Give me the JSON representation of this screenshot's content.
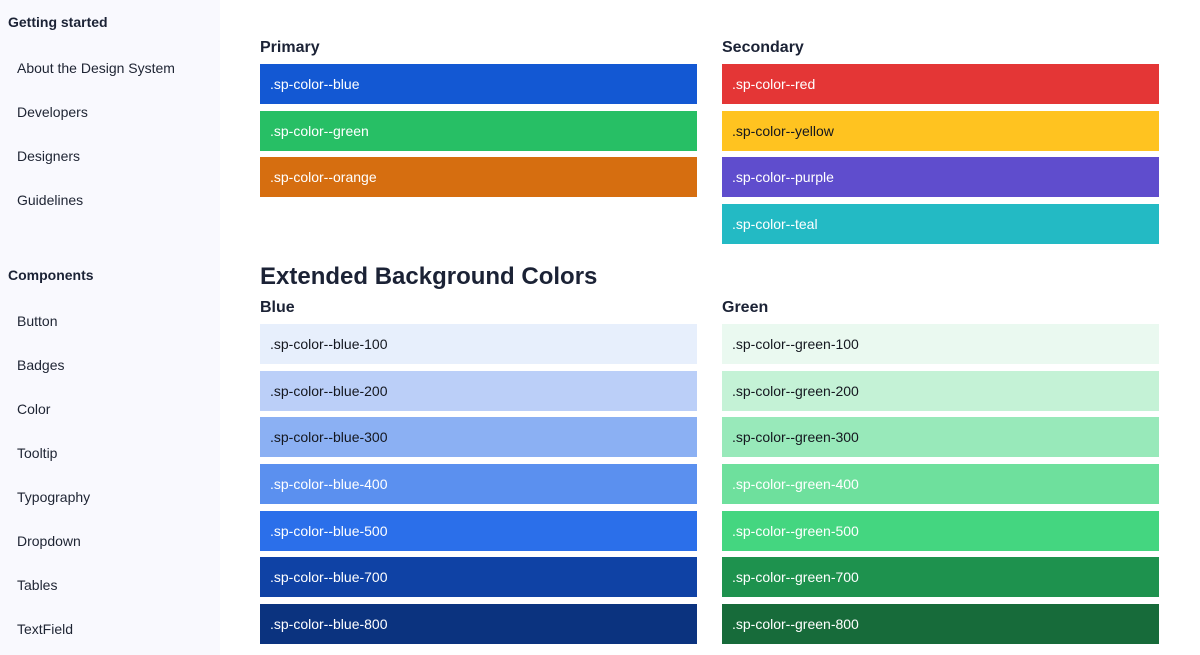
{
  "sidebar": {
    "getting_started": {
      "heading": "Getting started",
      "items": [
        {
          "label": "About the Design System"
        },
        {
          "label": "Developers"
        },
        {
          "label": "Designers"
        },
        {
          "label": "Guidelines"
        }
      ]
    },
    "components": {
      "heading": "Components",
      "items": [
        {
          "label": "Button"
        },
        {
          "label": "Badges"
        },
        {
          "label": "Color"
        },
        {
          "label": "Tooltip"
        },
        {
          "label": "Typography"
        },
        {
          "label": "Dropdown"
        },
        {
          "label": "Tables"
        },
        {
          "label": "TextField"
        }
      ]
    }
  },
  "main": {
    "primary": {
      "heading": "Primary",
      "swatches": [
        {
          "label": ".sp-color--blue",
          "color": "#1358d3",
          "text": "light"
        },
        {
          "label": ".sp-color--green",
          "color": "#27bf65",
          "text": "light"
        },
        {
          "label": ".sp-color--orange",
          "color": "#d66e10",
          "text": "light"
        }
      ]
    },
    "secondary": {
      "heading": "Secondary",
      "swatches": [
        {
          "label": ".sp-color--red",
          "color": "#e43636",
          "text": "light"
        },
        {
          "label": ".sp-color--yellow",
          "color": "#ffc320",
          "text": "dark"
        },
        {
          "label": ".sp-color--purple",
          "color": "#5f4dcd",
          "text": "light"
        },
        {
          "label": ".sp-color--teal",
          "color": "#23bac4",
          "text": "light"
        }
      ]
    },
    "extended": {
      "heading": "Extended Background Colors",
      "blue": {
        "heading": "Blue",
        "swatches": [
          {
            "label": ".sp-color--blue-100",
            "color": "#e7effc",
            "text": "dark"
          },
          {
            "label": ".sp-color--blue-200",
            "color": "#bbcff8",
            "text": "dark"
          },
          {
            "label": ".sp-color--blue-300",
            "color": "#8bb0f3",
            "text": "dark"
          },
          {
            "label": ".sp-color--blue-400",
            "color": "#5b90ef",
            "text": "light"
          },
          {
            "label": ".sp-color--blue-500",
            "color": "#2b6fea",
            "text": "light"
          },
          {
            "label": ".sp-color--blue-700",
            "color": "#0f42a5",
            "text": "light"
          },
          {
            "label": ".sp-color--blue-800",
            "color": "#0b337f",
            "text": "light"
          }
        ]
      },
      "green": {
        "heading": "Green",
        "swatches": [
          {
            "label": ".sp-color--green-100",
            "color": "#eaf9f0",
            "text": "dark"
          },
          {
            "label": ".sp-color--green-200",
            "color": "#c4f2d6",
            "text": "dark"
          },
          {
            "label": ".sp-color--green-300",
            "color": "#98e9ba",
            "text": "dark"
          },
          {
            "label": ".sp-color--green-400",
            "color": "#6ee09d",
            "text": "light"
          },
          {
            "label": ".sp-color--green-500",
            "color": "#44d680",
            "text": "light"
          },
          {
            "label": ".sp-color--green-700",
            "color": "#1e924e",
            "text": "light"
          },
          {
            "label": ".sp-color--green-800",
            "color": "#176b3a",
            "text": "light"
          }
        ]
      }
    }
  }
}
